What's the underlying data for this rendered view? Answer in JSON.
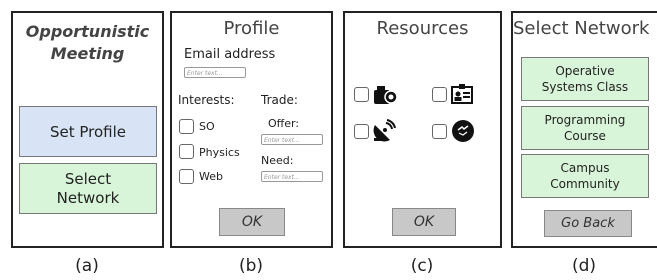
{
  "panel_a": {
    "title_line1": "Opportunistic",
    "title_line2": "Meeting",
    "set_profile_label": "Set Profile",
    "select_network_line1": "Select",
    "select_network_line2": "Network",
    "caption": "(a)"
  },
  "panel_b": {
    "title": "Profile",
    "email_label": "Email address",
    "email_placeholder": "Enter text...",
    "interests_label": "Interests:",
    "interests": [
      "SO",
      "Physics",
      "Web"
    ],
    "trade_label": "Trade:",
    "offer_label": "Offer:",
    "offer_placeholder": "Enter text...",
    "need_label": "Need:",
    "need_placeholder": "Enter text...",
    "ok_label": "OK",
    "caption": "(b)"
  },
  "panel_c": {
    "title": "Resources",
    "resources": [
      "camera-icon",
      "id-card-icon",
      "satellite-dish-icon",
      "trade-icon"
    ],
    "ok_label": "OK",
    "caption": "(c)"
  },
  "panel_d": {
    "title": "Select Network",
    "networks": [
      {
        "line1": "Operative",
        "line2": "Systems Class"
      },
      {
        "line1": "Programming",
        "line2": "Course"
      },
      {
        "line1": "Campus",
        "line2": "Community"
      }
    ],
    "go_back_label": "Go Back",
    "caption": "(d)"
  },
  "colors": {
    "blue_button": "#d8e4f5",
    "green_button": "#d9f5d9",
    "gray_button": "#c8c8c8"
  }
}
